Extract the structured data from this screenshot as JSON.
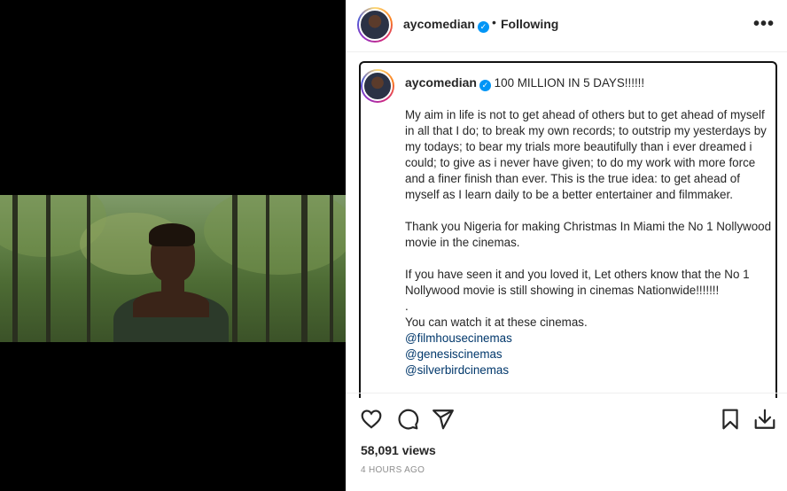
{
  "header": {
    "username": "aycomedian",
    "separator": "•",
    "follow_status": "Following",
    "more": "•••"
  },
  "caption": {
    "username": "aycomedian",
    "headline": "100 MILLION IN 5 DAYS!!!!!!",
    "paragraph1": "My aim in life is not to get ahead of others but to get ahead of myself in all that I do; to break my own records; to outstrip my yesterdays by my todays; to bear my trials more beautifully than i ever dreamed i could; to give as i never have given; to do my work with more force and a finer finish than ever. This is the true idea: to get ahead of myself as I learn daily to be a better entertainer and filmmaker.",
    "paragraph2": "Thank you Nigeria for making Christmas In Miami the No 1 Nollywood movie in the cinemas.",
    "paragraph3": "If you have seen it and you loved it, Let others know that the No 1 Nollywood movie is still showing in cinemas Nationwide!!!!!!!",
    "dot_line": ".",
    "paragraph4": "You can watch it at these cinemas.",
    "mentions": [
      "@filmhousecinemas",
      "@genesiscinemas",
      "@silverbirdcinemas"
    ]
  },
  "actions": {
    "icons": [
      "heart-icon",
      "comment-icon",
      "share-icon",
      "bookmark-icon",
      "download-icon"
    ]
  },
  "stats": {
    "views": "58,091 views",
    "time": "4 HOURS AGO"
  },
  "colors": {
    "verified": "#0095f6",
    "mention": "#00376b",
    "muted": "#8e8e8e"
  }
}
